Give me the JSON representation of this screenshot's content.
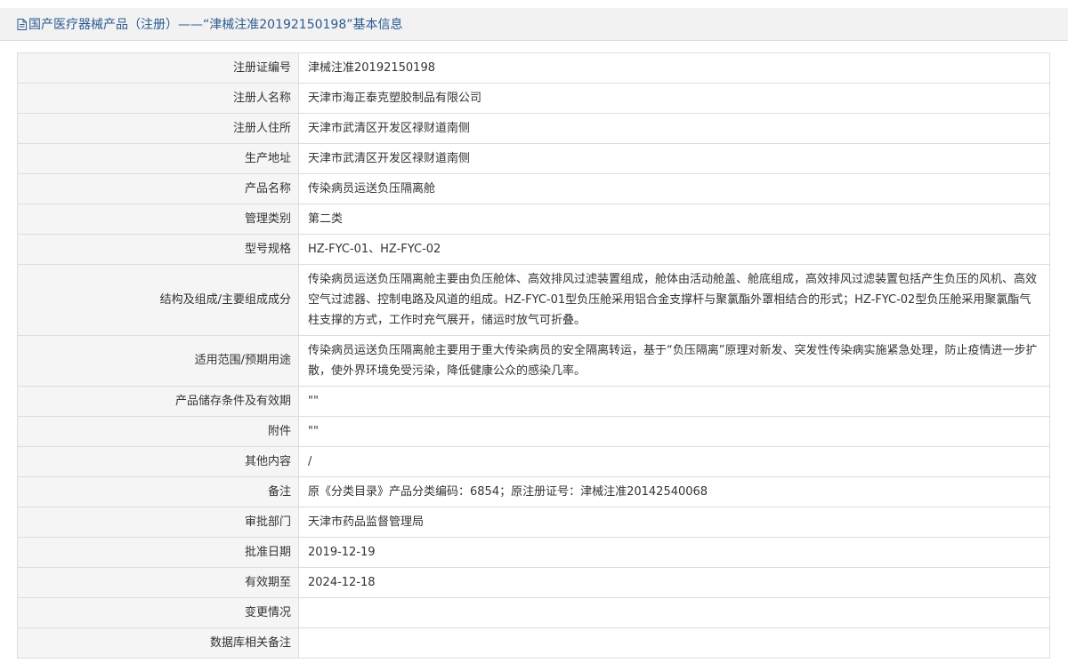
{
  "header": {
    "title": "国产医疗器械产品（注册）——“津械注准20192150198”基本信息",
    "icon": "document-icon",
    "color": "#2b5a92"
  },
  "rows": [
    {
      "label": "注册证编号",
      "value": "津械注准20192150198"
    },
    {
      "label": "注册人名称",
      "value": "天津市海正泰克塑胶制品有限公司"
    },
    {
      "label": "注册人住所",
      "value": "天津市武清区开发区禄财道南侧"
    },
    {
      "label": "生产地址",
      "value": "天津市武清区开发区禄财道南侧"
    },
    {
      "label": "产品名称",
      "value": "传染病员运送负压隔离舱"
    },
    {
      "label": "管理类别",
      "value": "第二类"
    },
    {
      "label": "型号规格",
      "value": "HZ-FYC-01、HZ-FYC-02"
    },
    {
      "label": "结构及组成/主要组成成分",
      "value": "传染病员运送负压隔离舱主要由负压舱体、高效排风过滤装置组成，舱体由活动舱盖、舱底组成，高效排风过滤装置包括产生负压的风机、高效空气过滤器、控制电路及风道的组成。HZ-FYC-01型负压舱采用铝合金支撑杆与聚氯酯外罩相结合的形式；HZ-FYC-02型负压舱采用聚氯酯气柱支撑的方式，工作时充气展开，储运时放气可折叠。"
    },
    {
      "label": "适用范围/预期用途",
      "value": "传染病员运送负压隔离舱主要用于重大传染病员的安全隔离转运，基于“负压隔离”原理对新发、突发性传染病实施紧急处理，防止疫情进一步扩散，使外界环境免受污染，降低健康公众的感染几率。"
    },
    {
      "label": "产品储存条件及有效期",
      "value": "\"\""
    },
    {
      "label": "附件",
      "value": "\"\""
    },
    {
      "label": "其他内容",
      "value": "/"
    },
    {
      "label": "备注",
      "value": "原《分类目录》产品分类编码：6854；原注册证号：津械注准20142540068"
    },
    {
      "label": "审批部门",
      "value": "天津市药品监督管理局"
    },
    {
      "label": "批准日期",
      "value": "2019-12-19"
    },
    {
      "label": "有效期至",
      "value": "2024-12-18"
    },
    {
      "label": "变更情况",
      "value": ""
    },
    {
      "label": "数据库相关备注",
      "value": ""
    }
  ]
}
